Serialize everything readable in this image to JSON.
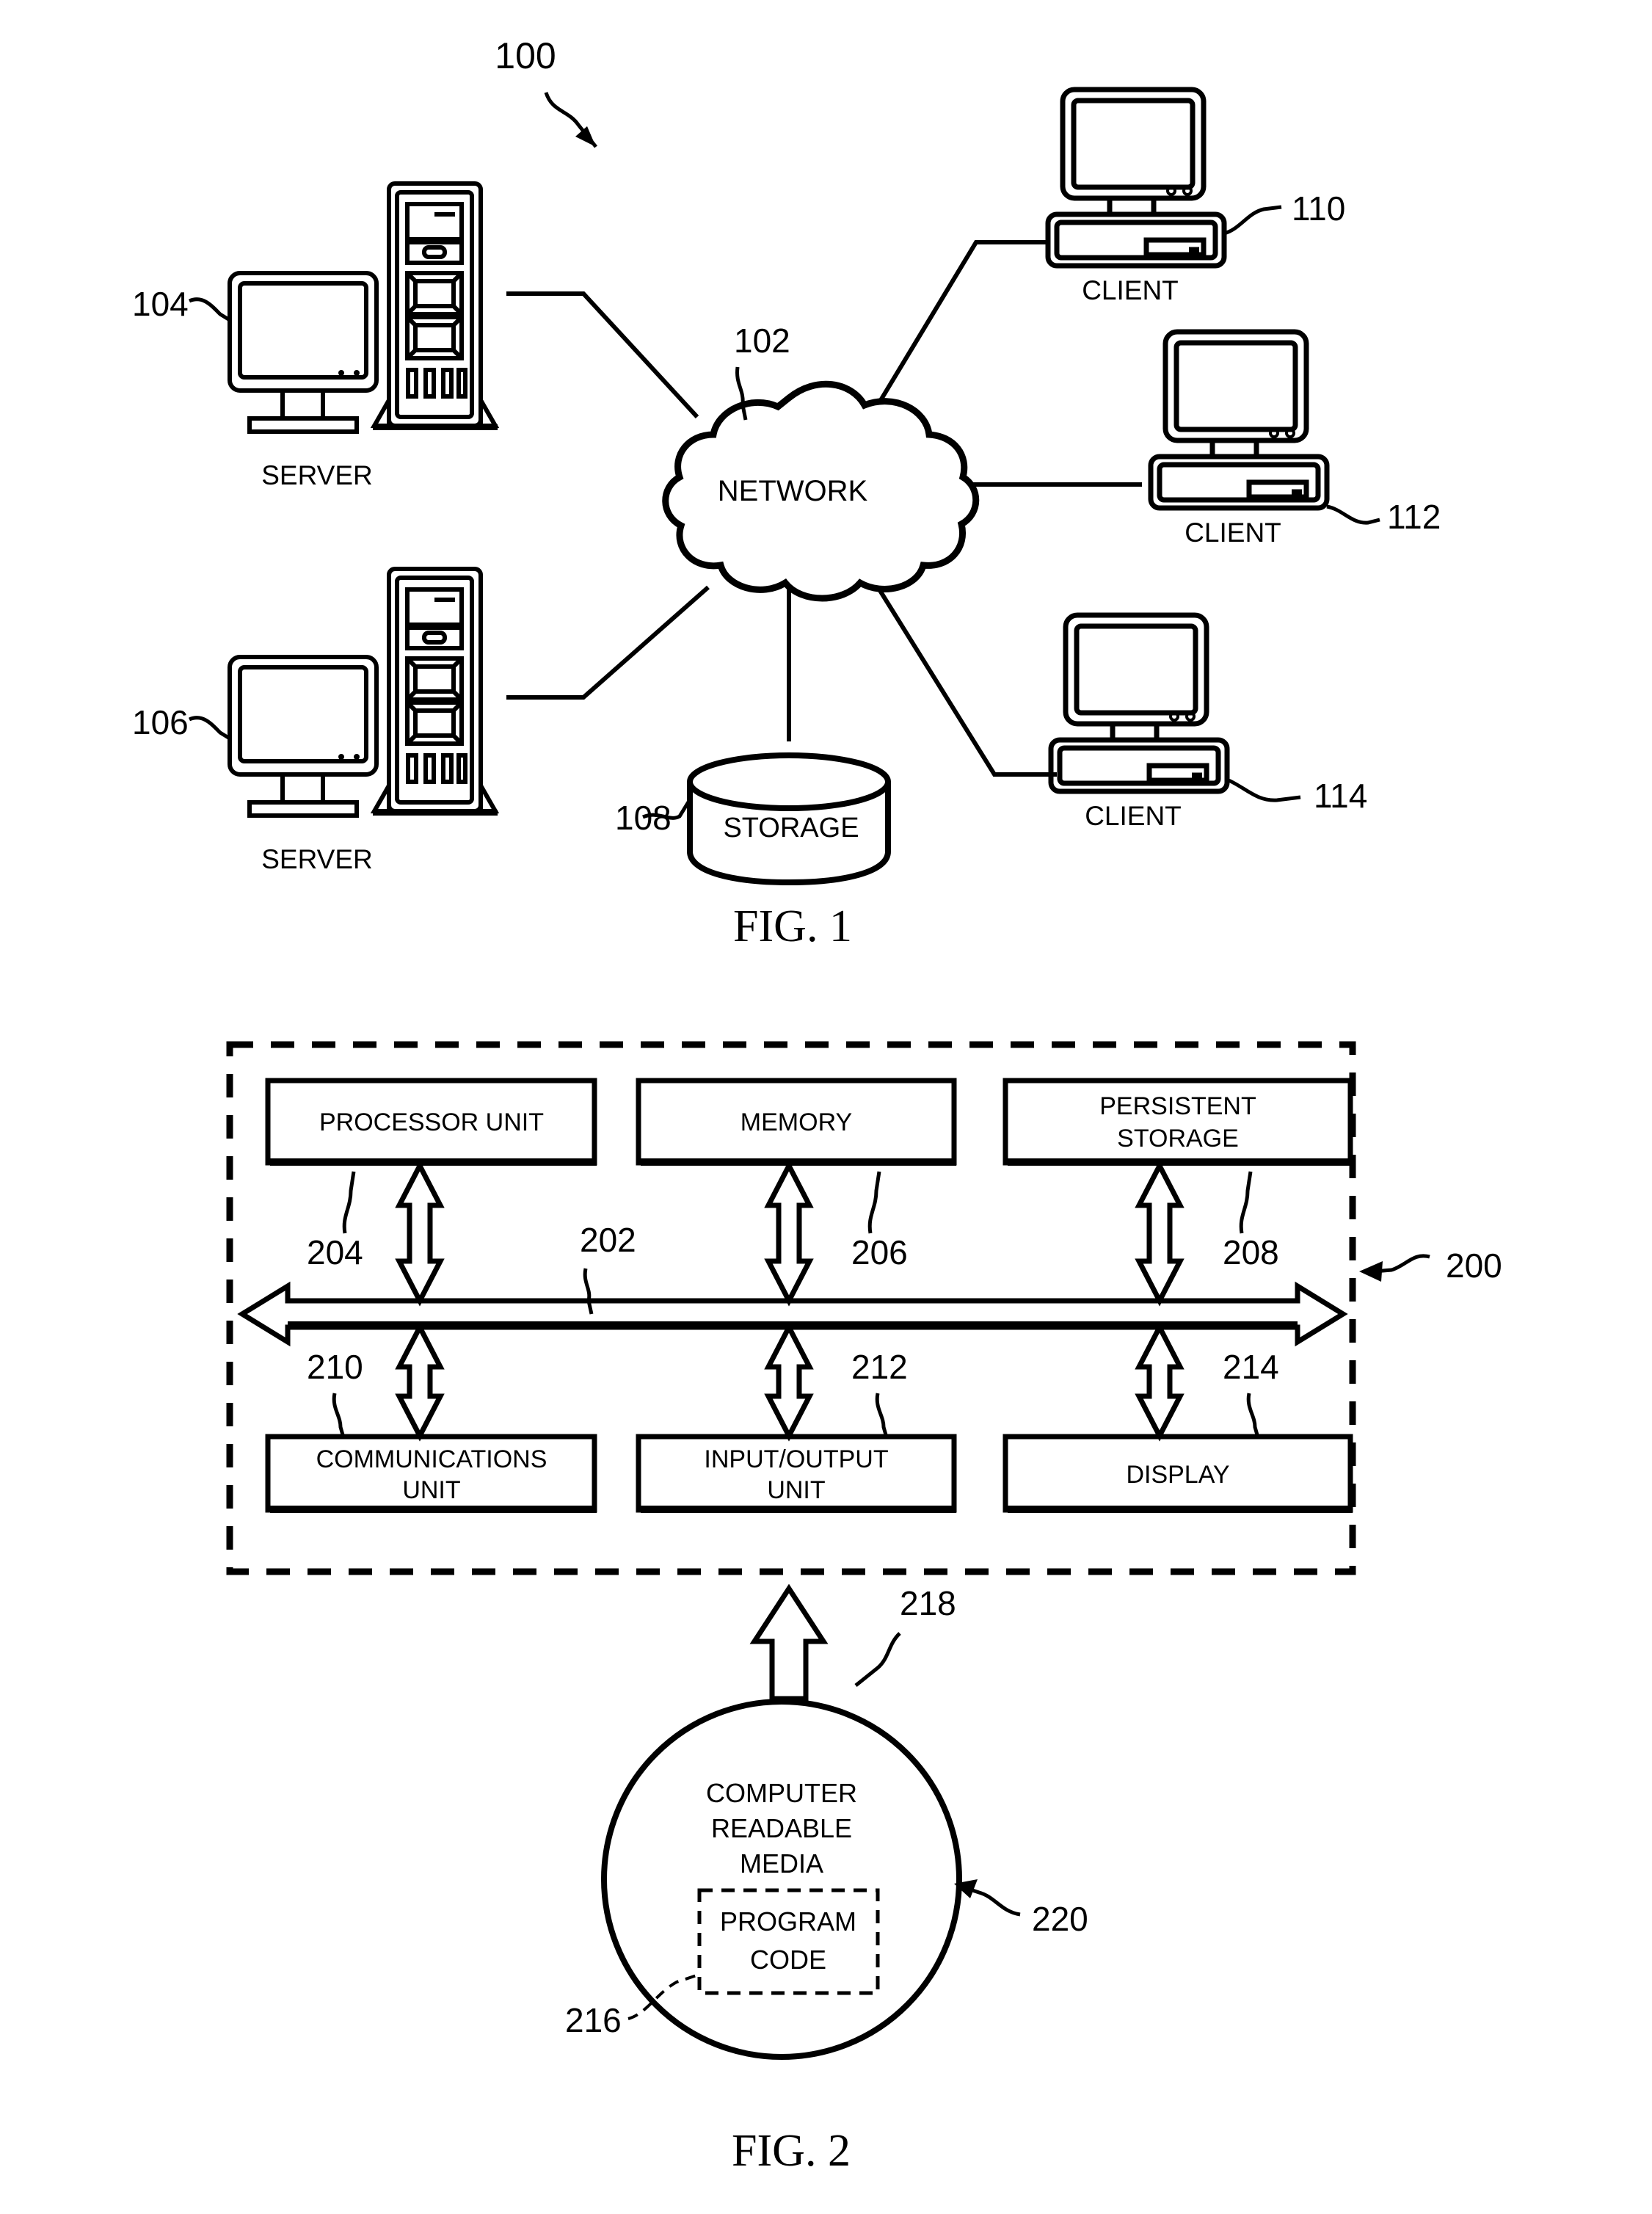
{
  "document": {
    "type": "patent-drawing-sheet",
    "figures": [
      {
        "caption": "FIG. 1",
        "ref": "100",
        "nodes": [
          {
            "id": "104",
            "label": "SERVER",
            "kind": "server-tower-with-monitor"
          },
          {
            "id": "106",
            "label": "SERVER",
            "kind": "server-tower-with-monitor"
          },
          {
            "id": "102",
            "label": "NETWORK",
            "kind": "cloud"
          },
          {
            "id": "108",
            "label": "STORAGE",
            "kind": "cylinder"
          },
          {
            "id": "110",
            "label": "CLIENT",
            "kind": "desktop-computer"
          },
          {
            "id": "112",
            "label": "CLIENT",
            "kind": "desktop-computer"
          },
          {
            "id": "114",
            "label": "CLIENT",
            "kind": "desktop-computer"
          }
        ]
      },
      {
        "caption": "FIG. 2",
        "ref": "200",
        "bus_ref": "202",
        "boxes": [
          {
            "id": "204",
            "label": "PROCESSOR UNIT",
            "lines": [
              "PROCESSOR UNIT"
            ]
          },
          {
            "id": "206",
            "label": "MEMORY",
            "lines": [
              "MEMORY"
            ]
          },
          {
            "id": "208",
            "label": "PERSISTENT STORAGE",
            "lines": [
              "PERSISTENT",
              "STORAGE"
            ]
          },
          {
            "id": "210",
            "label": "COMMUNICATIONS UNIT",
            "lines": [
              "COMMUNICATIONS",
              "UNIT"
            ]
          },
          {
            "id": "212",
            "label": "INPUT/OUTPUT UNIT",
            "lines": [
              "INPUT/OUTPUT",
              "UNIT"
            ]
          },
          {
            "id": "214",
            "label": "DISPLAY",
            "lines": [
              "DISPLAY"
            ]
          }
        ],
        "media": {
          "id": "218",
          "lines": [
            "COMPUTER",
            "READABLE",
            "MEDIA"
          ],
          "inner": {
            "id": "216",
            "lines": [
              "PROGRAM",
              "CODE"
            ]
          },
          "pointer_ref": "220"
        }
      }
    ]
  },
  "colors": {
    "ink": "#000000",
    "paper": "#ffffff"
  }
}
